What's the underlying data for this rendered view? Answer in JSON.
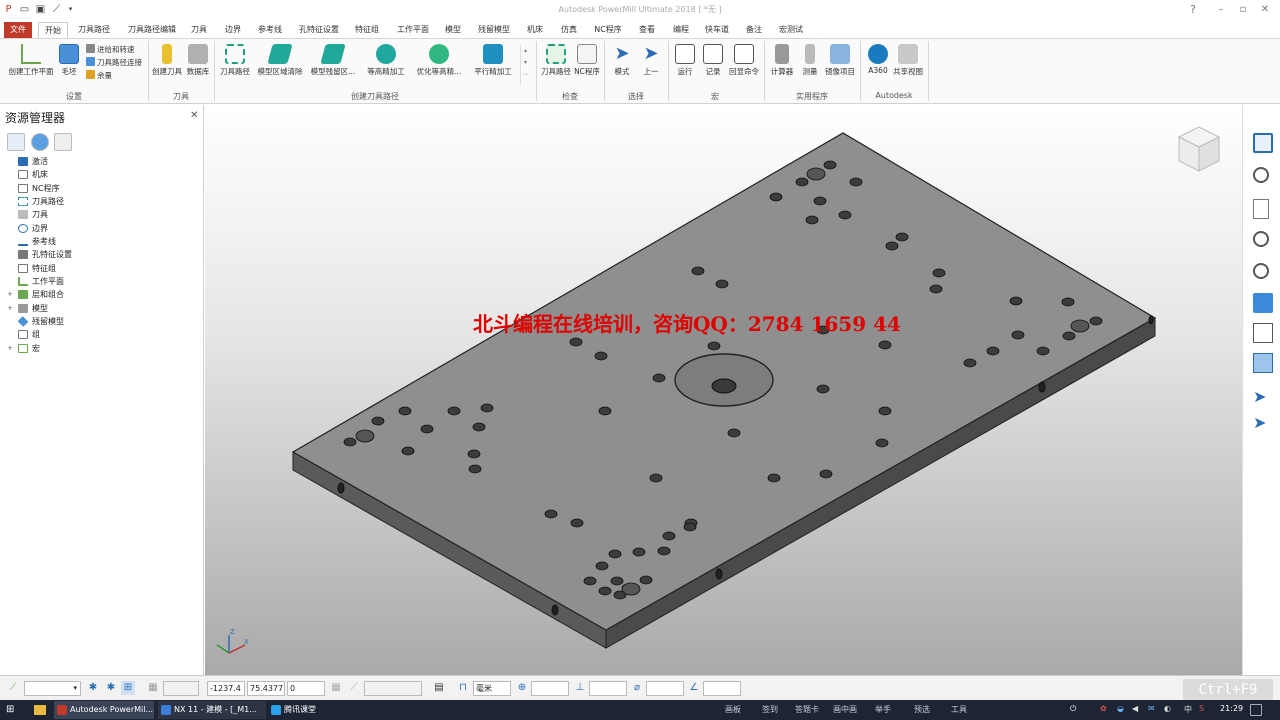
{
  "window": {
    "title": "Autodesk PowerMill Ultimate 2018   [ *无 ]",
    "help_icon": "help-icon",
    "controls": [
      "minimize-icon",
      "restore-icon",
      "close-icon"
    ]
  },
  "tabs": [
    "文件",
    "开始",
    "刀具路径",
    "刀具路径编辑",
    "刀具",
    "边界",
    "参考线",
    "孔特征设置",
    "特征组",
    "工作平面",
    "模型",
    "残留模型",
    "机床",
    "仿真",
    "NC程序",
    "查看",
    "编程",
    "快车道",
    "备注",
    "宏测试"
  ],
  "active_tab": "开始",
  "ribbon": {
    "groups": [
      {
        "label": "设置",
        "buttons": [
          {
            "label": "创建工作平面",
            "icon": "workplane-icon"
          },
          {
            "label": "毛坯",
            "icon": "block-icon"
          }
        ],
        "small": [
          {
            "label": "进给和转速",
            "icon": "feed-icon"
          },
          {
            "label": "刀具路径连接",
            "icon": "link-icon"
          },
          {
            "label": "余量",
            "icon": "thickness-icon"
          }
        ]
      },
      {
        "label": "刀具",
        "buttons": [
          {
            "label": "创建刀具",
            "icon": "tool-icon"
          },
          {
            "label": "数据库",
            "icon": "database-icon"
          }
        ]
      },
      {
        "label": "创建刀具路径",
        "buttons": [
          {
            "label": "刀具路径",
            "icon": "toolpath-icon"
          },
          {
            "label": "模型区域清除",
            "icon": "area-clear-icon"
          },
          {
            "label": "模型残留区...",
            "icon": "rest-clear-icon"
          },
          {
            "label": "等高精加工",
            "icon": "constant-z-icon"
          },
          {
            "label": "优化等高精...",
            "icon": "optimised-z-icon"
          },
          {
            "label": "平行精加工",
            "icon": "raster-icon"
          }
        ]
      },
      {
        "label": "检查",
        "buttons": [
          {
            "label": "刀具路径",
            "icon": "verify-toolpath-icon"
          },
          {
            "label": "NC程序",
            "icon": "verify-nc-icon"
          }
        ]
      },
      {
        "label": "选择",
        "buttons": [
          {
            "label": "模式",
            "icon": "select-mode-icon"
          },
          {
            "label": "上一",
            "icon": "select-previous-icon"
          }
        ]
      },
      {
        "label": "宏",
        "buttons": [
          {
            "label": "运行",
            "icon": "run-macro-icon"
          },
          {
            "label": "记录",
            "icon": "record-macro-icon"
          },
          {
            "label": "回显命令",
            "icon": "echo-command-icon"
          }
        ]
      },
      {
        "label": "实用程序",
        "buttons": [
          {
            "label": "计算器",
            "icon": "calculator-icon"
          },
          {
            "label": "测量",
            "icon": "measure-icon"
          },
          {
            "label": "镜像项目",
            "icon": "mirror-icon"
          }
        ]
      },
      {
        "label": "Autodesk",
        "buttons": [
          {
            "label": "A360",
            "icon": "a360-icon"
          },
          {
            "label": "共享视图",
            "icon": "share-view-icon"
          }
        ]
      }
    ]
  },
  "explorer": {
    "title": "资源管理器",
    "items": [
      {
        "label": "激活",
        "expander": ""
      },
      {
        "label": "机床",
        "expander": ""
      },
      {
        "label": "NC程序",
        "expander": ""
      },
      {
        "label": "刀具路径",
        "expander": ""
      },
      {
        "label": "刀具",
        "expander": ""
      },
      {
        "label": "边界",
        "expander": ""
      },
      {
        "label": "参考线",
        "expander": ""
      },
      {
        "label": "孔特征设置",
        "expander": ""
      },
      {
        "label": "特征组",
        "expander": ""
      },
      {
        "label": "工作平面",
        "expander": ""
      },
      {
        "label": "层和组合",
        "expander": "+"
      },
      {
        "label": "模型",
        "expander": "+"
      },
      {
        "label": "残留模型",
        "expander": ""
      },
      {
        "label": "组",
        "expander": ""
      },
      {
        "label": "宏",
        "expander": "+"
      }
    ]
  },
  "viewport": {
    "watermark": "北斗编程在线培训，咨询QQ：2784 1659 44",
    "view_cube": "view-cube-icon",
    "axis_triad": "axis-triad-icon"
  },
  "status": {
    "x": "-1237.4",
    "y": "75.4377",
    "z": "0",
    "units": "毫米",
    "hint": "Ctrl+F9"
  },
  "taskbar": {
    "apps": [
      "Autodesk PowerMil...",
      "NX 11 - 建模 - [_M1...",
      "腾讯课堂"
    ],
    "tray_items": [
      "画板",
      "签到",
      "答题卡",
      "画中画",
      "举手",
      "预选",
      "工具"
    ],
    "clock": "21:29"
  },
  "colors": {
    "file_tab": "#c0392b",
    "accent": "#2a6db5",
    "watermark": "#e00000"
  }
}
